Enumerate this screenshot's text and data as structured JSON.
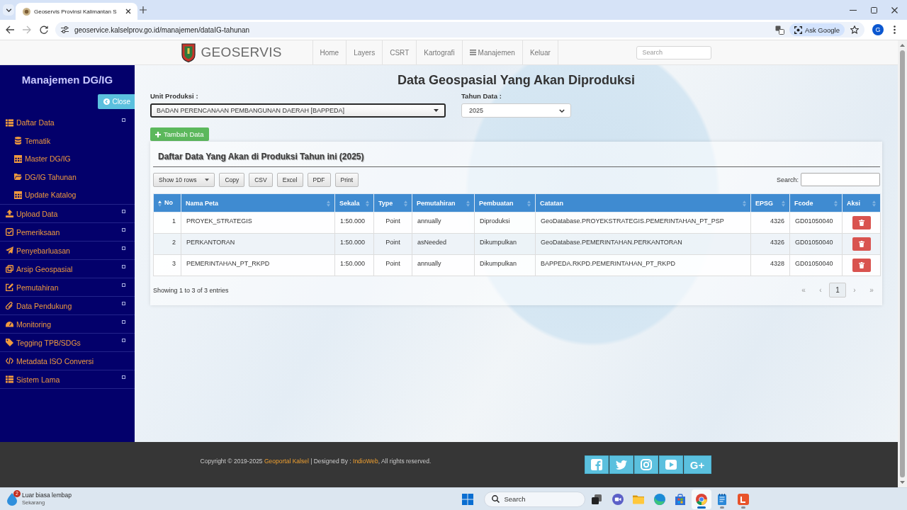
{
  "browser": {
    "tab": {
      "title": "Geoservis Provinsi Kalimantan S"
    },
    "url": "geoservice.kalselprov.go.id/manajemen/dataIG-tahunan",
    "back": {
      "disabled": false
    },
    "forward": {
      "disabled": true
    },
    "ask_google": "Ask Google",
    "profile_initial": "G"
  },
  "navbar": {
    "brand": "GEOSERVIS",
    "items": [
      {
        "label": "Home",
        "kind": "link"
      },
      {
        "label": "Layers",
        "kind": "link"
      },
      {
        "label": "CSRT",
        "kind": "link"
      },
      {
        "label": "Kartografi",
        "kind": "link"
      },
      {
        "label": "Manajemen",
        "kind": "menu"
      },
      {
        "label": "Keluar",
        "kind": "link"
      }
    ],
    "search": {
      "placeholder": "Search"
    }
  },
  "sidebar": {
    "title": "Manajemen DG/IG",
    "close_button": "Close",
    "items": [
      {
        "label": "Daftar Data",
        "expandable": true,
        "children": [
          {
            "label": "Tematik"
          },
          {
            "label": "Master DG/IG"
          },
          {
            "label": "DG/IG Tahunan"
          },
          {
            "label": "Update Katalog"
          }
        ]
      },
      {
        "label": "Upload Data",
        "expandable": true
      },
      {
        "label": "Pemeriksaan",
        "expandable": true
      },
      {
        "label": "Penyebarluasan",
        "expandable": true
      },
      {
        "label": "Arsip Geospasial",
        "expandable": true
      },
      {
        "label": "Pemutahiran",
        "expandable": true
      },
      {
        "label": "Data Pendukung",
        "expandable": true
      },
      {
        "label": "Monitoring",
        "expandable": true
      },
      {
        "label": "Tegging TPB/SDGs",
        "expandable": true
      },
      {
        "label": "Metadata ISO Conversi",
        "expandable": false
      },
      {
        "label": "Sistem Lama",
        "expandable": true
      }
    ]
  },
  "page": {
    "title": "Data Geospasial Yang Akan Diproduksi",
    "unit": {
      "label": "Unit Produksi :",
      "value": "BADAN PERENCANAAN PEMBANGUNAN DAERAH [BAPPEDA]",
      "focused": true
    },
    "year": {
      "label": "Tahun Data :",
      "value": "2025"
    },
    "add_button": "Tambah Data"
  },
  "table_panel": {
    "title": "Daftar Data Yang Akan di Produksi Tahun ini (2025)",
    "buttons": [
      {
        "label": "Show 10 rows",
        "kind": "dropdown"
      },
      {
        "label": "Copy",
        "kind": "button"
      },
      {
        "label": "CSV",
        "kind": "button"
      },
      {
        "label": "Excel",
        "kind": "button"
      },
      {
        "label": "PDF",
        "kind": "button"
      },
      {
        "label": "Print",
        "kind": "button"
      }
    ],
    "search_label": "Search:",
    "columns": [
      {
        "label": "No",
        "sorted": true,
        "kind": "text"
      },
      {
        "label": "Nama Peta",
        "sorted": false,
        "kind": "text"
      },
      {
        "label": "Sekala",
        "sorted": false,
        "kind": "text"
      },
      {
        "label": "Type",
        "sorted": false,
        "kind": "text"
      },
      {
        "label": "Pemutahiran",
        "sorted": false,
        "kind": "text"
      },
      {
        "label": "Pembuatan",
        "sorted": false,
        "kind": "text"
      },
      {
        "label": "Catatan",
        "sorted": false,
        "kind": "text"
      },
      {
        "label": "EPSG",
        "sorted": false,
        "kind": "text"
      },
      {
        "label": "Fcode",
        "sorted": false,
        "kind": "text"
      },
      {
        "label": "Aksi",
        "sorted": false,
        "kind": "action"
      }
    ],
    "rows": [
      [
        "1",
        "PROYEK_STRATEGIS",
        "1:50.000",
        "Point",
        "annually",
        "Diproduksi",
        "GeoDatabase.PROYEKSTRATEGIS.PEMERINTAHAN_PT_PSP",
        "4326",
        "GD01050040"
      ],
      [
        "2",
        "PERKANTORAN",
        "1:50.000",
        "Point",
        "asNeeded",
        "Dikumpulkan",
        "GeoDatabase.PEMERINTAHAN.PERKANTORAN",
        "4326",
        "GD01050040"
      ],
      [
        "3",
        "PEMERINTAHAN_PT_RKPD",
        "1:50.000",
        "Point",
        "annually",
        "Dikumpulkan",
        "BAPPEDA.RKPD.PEMERINTAHAN_PT_RKPD",
        "4328",
        "GD01050040"
      ]
    ],
    "info": "Showing 1 to 3 of 3 entries",
    "pagination": [
      {
        "label": "«",
        "selected": false
      },
      {
        "label": "‹",
        "selected": false
      },
      {
        "label": "1",
        "selected": true
      },
      {
        "label": "›",
        "selected": false
      },
      {
        "label": "»",
        "selected": false
      }
    ]
  },
  "footer": {
    "copyright": [
      {
        "text": "Copyright © 2019-2025 ",
        "link": false
      },
      {
        "text": "Geoportal Kalsel",
        "link": true
      },
      {
        "text": " | Designed By : ",
        "link": false
      },
      {
        "text": "IndioWeb",
        "link": true
      },
      {
        "text": ", All rights reserved.",
        "link": false
      }
    ],
    "social": [
      {
        "kind": "icon"
      },
      {
        "kind": "icon"
      },
      {
        "kind": "icon"
      },
      {
        "kind": "icon"
      },
      {
        "kind": "text",
        "label": "G+"
      }
    ]
  },
  "taskbar": {
    "notification": {
      "title": "Luar biasa lembap",
      "subtitle": "Sekarang",
      "badge": "2"
    },
    "search": {
      "placeholder": "Search"
    },
    "apps": [
      {
        "running": false,
        "selected": false
      },
      {
        "running": false,
        "selected": false
      },
      {
        "running": false,
        "selected": false
      },
      {
        "running": false,
        "selected": false
      },
      {
        "running": false,
        "selected": false
      },
      {
        "running": true,
        "selected": true
      },
      {
        "running": true,
        "selected": false
      },
      {
        "running": true,
        "selected": false
      }
    ]
  }
}
